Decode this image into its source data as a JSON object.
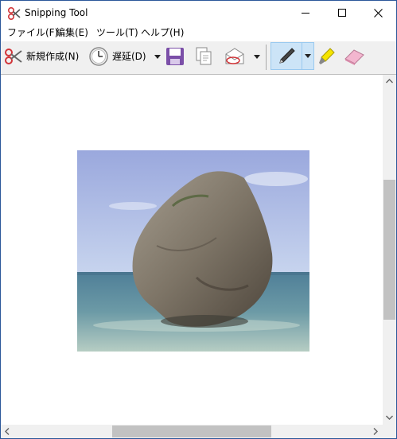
{
  "window": {
    "title": "Snipping Tool"
  },
  "menu": [
    {
      "label": "ファイル(F)"
    },
    {
      "label": "編集(E)"
    },
    {
      "label": "ツール(T)"
    },
    {
      "label": "ヘルプ(H)"
    }
  ],
  "toolbar": {
    "new_label": "新規作成(N)",
    "delay_label": "遅延(D)",
    "tools": [
      "save-icon",
      "copy-icon",
      "send-snip-icon",
      "pen-icon",
      "highlighter-icon",
      "eraser-icon"
    ],
    "active_tool": "pen-icon"
  },
  "colors": {
    "accent": "#cce4f7",
    "border": "#2b579a",
    "toolbar_bg": "#f0f0f0"
  }
}
